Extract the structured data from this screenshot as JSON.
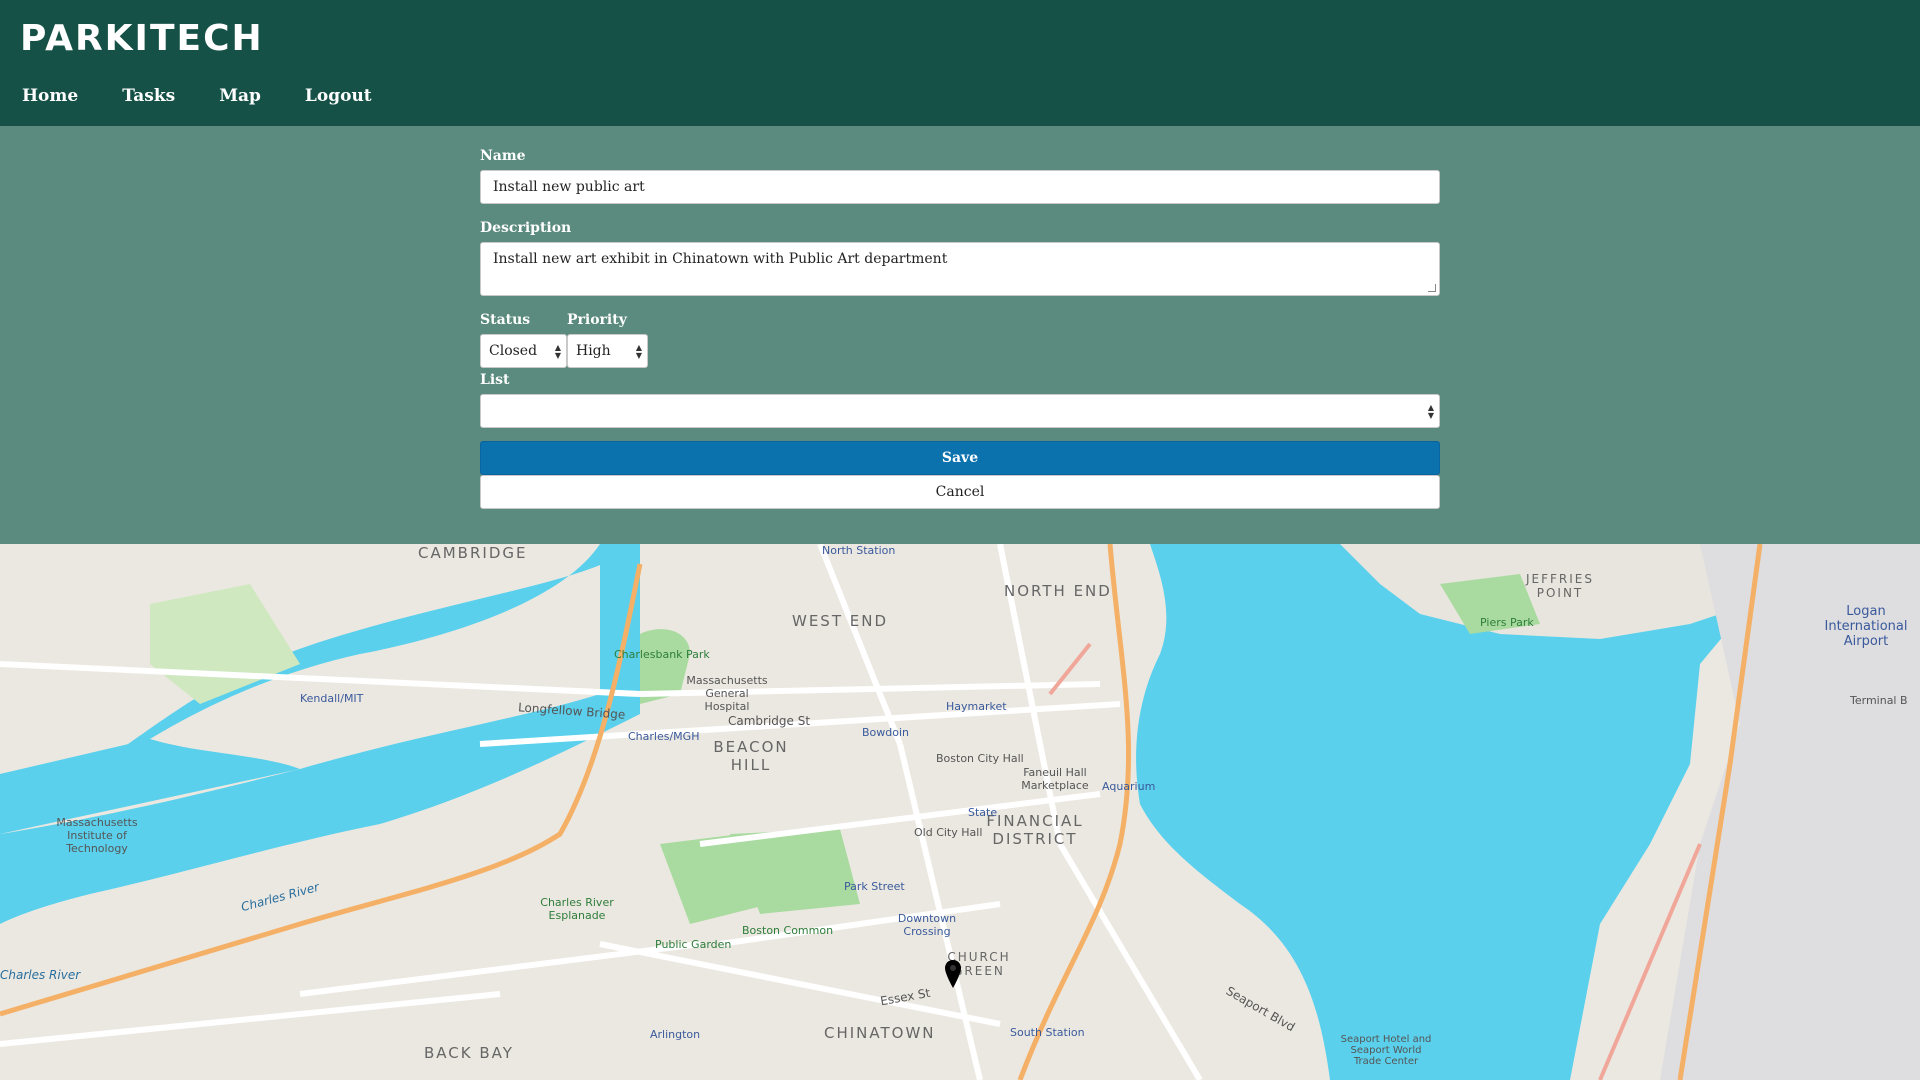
{
  "app": {
    "title": "PARKITECH"
  },
  "nav": {
    "home": "Home",
    "tasks": "Tasks",
    "map": "Map",
    "logout": "Logout"
  },
  "form": {
    "name_label": "Name",
    "name_value": "Install new public art",
    "description_label": "Description",
    "description_value": "Install new art exhibit in Chinatown with Public Art department",
    "status_label": "Status",
    "status_value": "Closed",
    "priority_label": "Priority",
    "priority_value": "High",
    "list_label": "List",
    "list_value": "",
    "save_label": "Save",
    "cancel_label": "Cancel"
  },
  "map": {
    "labels": {
      "cambridge": "CAMBRIDGE",
      "north_end": "NORTH END",
      "west_end": "WEST END",
      "beacon_hill": "BEACON HILL",
      "financial_district": "FINANCIAL DISTRICT",
      "church_green": "CHURCH GREEN",
      "chinatown": "CHINATOWN",
      "back_bay": "BACK BAY",
      "jeffries_point": "JEFFRIES POINT",
      "charles_river": "Charles River",
      "logan": "Logan International Airport",
      "boston_common": "Boston Common",
      "public_garden": "Public Garden",
      "esplanade": "Charles River Esplanade",
      "mit": "Massachusetts Institute of Technology",
      "mgh": "Massachusetts General Hospital",
      "north_station": "North Station",
      "haymarket": "Haymarket",
      "bowdoin": "Bowdoin",
      "state": "State",
      "aquarium": "Aquarium",
      "park_street": "Park Street",
      "downtown_crossing": "Downtown Crossing",
      "south_station": "South Station",
      "arlington": "Arlington",
      "kendall": "Kendall/MIT",
      "charles_mgh": "Charles/MGH",
      "cambridge_st": "Cambridge St",
      "longfellow": "Longfellow Bridge",
      "boston_city_hall": "Boston City Hall",
      "faneuil": "Faneuil Hall Marketplace",
      "old_city_hall": "Old City Hall",
      "piers_park": "Piers Park",
      "charlesbank": "Charlesbank Park",
      "seaport_hotel": "Seaport Hotel and Seaport World Trade Center",
      "terminal_b": "Terminal B",
      "essex_st": "Essex St",
      "seaport_blvd": "Seaport Blvd"
    }
  },
  "colors": {
    "header": "#165147",
    "panel": "#5b8a7e",
    "save": "#0b72ae",
    "water": "#5ad0ec"
  }
}
